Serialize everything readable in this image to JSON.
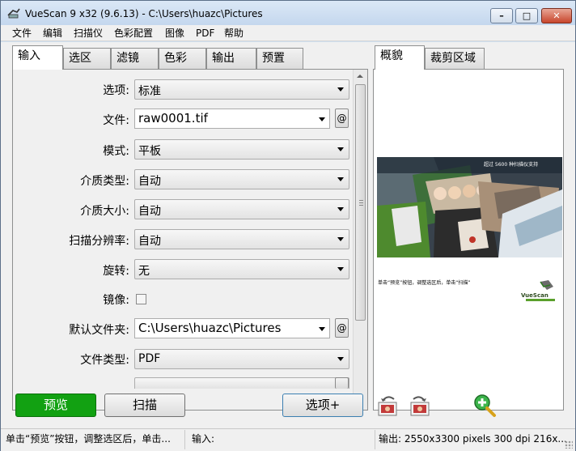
{
  "window": {
    "title": "VueScan 9 x32 (9.6.13) - C:\\Users\\huazc\\Pictures"
  },
  "menu": [
    "文件",
    "编辑",
    "扫描仪",
    "色彩配置",
    "图像",
    "PDF",
    "帮助"
  ],
  "left_tabs": [
    "输入",
    "选区",
    "滤镜",
    "色彩",
    "输出",
    "预置"
  ],
  "active_left_tab": "输入",
  "form": {
    "option": {
      "label": "选项:",
      "value": "标准"
    },
    "file": {
      "label": "文件:",
      "value": "raw0001.tif",
      "at": "@"
    },
    "mode": {
      "label": "模式:",
      "value": "平板"
    },
    "media_type": {
      "label": "介质类型:",
      "value": "自动"
    },
    "media_size": {
      "label": "介质大小:",
      "value": "自动"
    },
    "resolution": {
      "label": "扫描分辨率:",
      "value": "自动"
    },
    "rotate": {
      "label": "旋转:",
      "value": "无"
    },
    "mirror": {
      "label": "镜像:",
      "checked": false
    },
    "default_folder": {
      "label": "默认文件夹:",
      "value": "C:\\Users\\huazc\\Pictures",
      "at": "@"
    },
    "file_type": {
      "label": "文件类型:",
      "value": "PDF"
    }
  },
  "right_tabs": [
    "概貌",
    "裁剪区域"
  ],
  "active_right_tab": "概貌",
  "preview": {
    "banner": "超过 5600 种扫描仪支持",
    "caption": "单击“预览”按钮，调整选区后，单击“扫描”",
    "brand": "VueScan"
  },
  "buttons": {
    "preview": "预览",
    "scan": "扫描",
    "options": "选项+"
  },
  "status": {
    "left": "单击“预览”按钮，调整选区后，单击...",
    "middle": "输入:",
    "right": "输出: 2550x3300 pixels 300 dpi 216x..."
  },
  "colors": {
    "preview_button": "#12a112",
    "titlebar": "#c4d7ee",
    "close_button": "#c8452c"
  }
}
